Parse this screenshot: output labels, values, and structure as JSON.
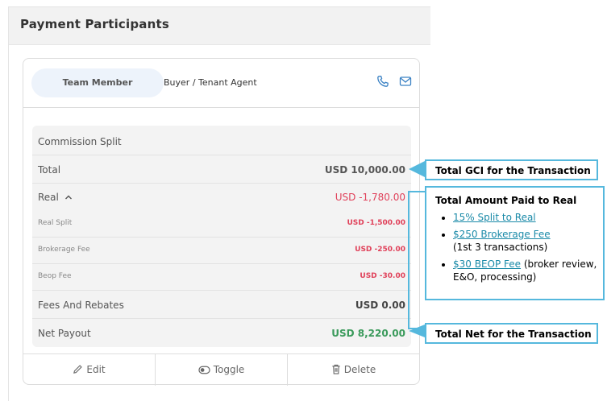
{
  "panel": {
    "title": "Payment Participants"
  },
  "member": {
    "pill_label": "Team Member",
    "role": "Buyer / Tenant Agent"
  },
  "icons": {
    "phone": "phone-icon",
    "mail": "mail-icon",
    "edit": "pencil-icon",
    "toggle": "toggle-icon",
    "delete": "trash-icon",
    "chevron": "chevron-up-icon"
  },
  "split": {
    "header": "Commission Split",
    "total": {
      "label": "Total",
      "value": "USD 10,000.00"
    },
    "real": {
      "label": "Real",
      "value": "USD -1,780.00"
    },
    "real_split": {
      "label": "Real Split",
      "value": "USD -1,500.00"
    },
    "brokerage_fee": {
      "label": "Brokerage Fee",
      "value": "USD -250.00"
    },
    "beop_fee": {
      "label": "Beop Fee",
      "value": "USD -30.00"
    },
    "fees_rebates": {
      "label": "Fees And Rebates",
      "value": "USD 0.00"
    },
    "net_payout": {
      "label": "Net Payout",
      "value": "USD 8,220.00"
    }
  },
  "actions": {
    "edit": "Edit",
    "toggle": "Toggle",
    "delete": "Delete"
  },
  "callouts": {
    "total_gci": "Total GCI for the Transaction",
    "paid_to_real": {
      "title": "Total Amount Paid to Real",
      "items": [
        {
          "link": "15% Split to Real",
          "note": ""
        },
        {
          "link": "$250 Brokerage Fee",
          "note": "(1st 3 transactions)"
        },
        {
          "link": "$30 BEOP Fee",
          "note": " (broker review, E&O, processing)"
        }
      ]
    },
    "total_net": "Total Net for the Transaction"
  },
  "colors": {
    "negative": "#e0415a",
    "positive": "#3a9a5b",
    "accent": "#3b82c4",
    "callout_border": "#55b8dd"
  }
}
